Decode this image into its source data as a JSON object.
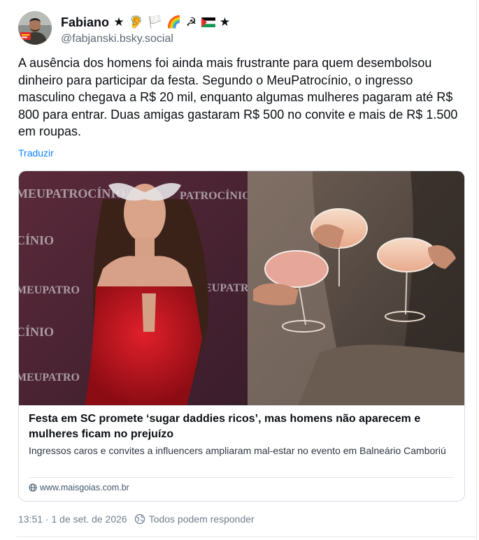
{
  "author": {
    "display_name": "Fabiano",
    "handle": "@fabjanski.bsky.social",
    "name_badges": [
      "★",
      "🦻",
      "🏳️",
      "🌈",
      "☭",
      "🇵🇸",
      "★"
    ]
  },
  "post": {
    "text": "A ausência dos homens foi ainda mais frustrante para quem desembolsou dinheiro para participar da festa. Segundo o MeuPatrocínio, o ingresso masculino chegava a R$ 20 mil, enquanto algumas mulheres pagaram até R$ 800 para entrar. Duas amigas gastaram R$ 500 no convite e mais de R$ 1.500 em roupas.",
    "translate_label": "Traduzir"
  },
  "link_card": {
    "title": "Festa em SC promete ‘sugar daddies ricos’, mas homens não aparecem e mulheres ficam no prejuízo",
    "description": "Ingressos caros e convites a influencers ampliaram mal-estar no evento em Balneário Camboriú",
    "domain": "www.maisgoias.com.br",
    "image_backdrop_text": [
      "MEUPATROCÍNIO",
      "PATROCÍNIO",
      "CÍNIO",
      "MEUPATRO",
      "MEUPATROCÍNIO",
      "CÍNIO",
      "MEUPATRO"
    ]
  },
  "footer": {
    "timestamp": "13:51 · 1 de set. de 2026",
    "reply_setting": "Todos podem responder"
  },
  "colors": {
    "text": "#0b0f14",
    "muted": "#5b6875",
    "link": "#1083fe",
    "border": "#d4dbe2",
    "dress_red": "#c0131d"
  }
}
